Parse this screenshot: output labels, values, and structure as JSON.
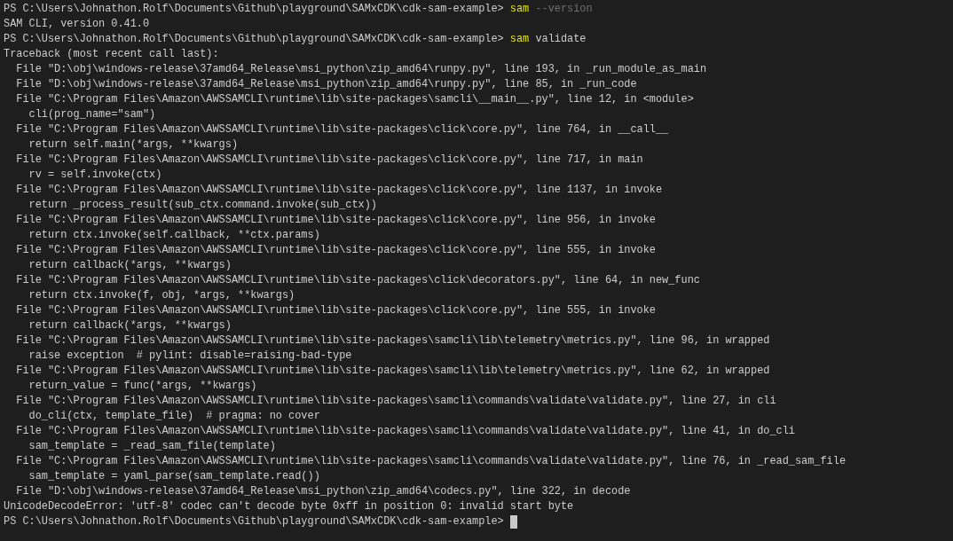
{
  "terminal": {
    "lines": [
      {
        "kind": "prompt",
        "prompt": "PS C:\\Users\\Johnathon.Rolf\\Documents\\Github\\playground\\SAMxCDK\\cdk-sam-example>",
        "tokens": [
          {
            "text": "sam",
            "kind": "command"
          },
          {
            "text": "--version",
            "kind": "parameter"
          }
        ],
        "cursor": false
      },
      {
        "kind": "output",
        "text": "SAM CLI, version 0.41.0"
      },
      {
        "kind": "prompt",
        "prompt": "PS C:\\Users\\Johnathon.Rolf\\Documents\\Github\\playground\\SAMxCDK\\cdk-sam-example>",
        "tokens": [
          {
            "text": "sam",
            "kind": "command"
          },
          {
            "text": "validate",
            "kind": "argument"
          }
        ],
        "cursor": false
      },
      {
        "kind": "output",
        "text": "Traceback (most recent call last):"
      },
      {
        "kind": "output",
        "text": "  File \"D:\\obj\\windows-release\\37amd64_Release\\msi_python\\zip_amd64\\runpy.py\", line 193, in _run_module_as_main"
      },
      {
        "kind": "output",
        "text": "  File \"D:\\obj\\windows-release\\37amd64_Release\\msi_python\\zip_amd64\\runpy.py\", line 85, in _run_code"
      },
      {
        "kind": "output",
        "text": "  File \"C:\\Program Files\\Amazon\\AWSSAMCLI\\runtime\\lib\\site-packages\\samcli\\__main__.py\", line 12, in <module>"
      },
      {
        "kind": "output",
        "text": "    cli(prog_name=\"sam\")"
      },
      {
        "kind": "output",
        "text": "  File \"C:\\Program Files\\Amazon\\AWSSAMCLI\\runtime\\lib\\site-packages\\click\\core.py\", line 764, in __call__"
      },
      {
        "kind": "output",
        "text": "    return self.main(*args, **kwargs)"
      },
      {
        "kind": "output",
        "text": "  File \"C:\\Program Files\\Amazon\\AWSSAMCLI\\runtime\\lib\\site-packages\\click\\core.py\", line 717, in main"
      },
      {
        "kind": "output",
        "text": "    rv = self.invoke(ctx)"
      },
      {
        "kind": "output",
        "text": "  File \"C:\\Program Files\\Amazon\\AWSSAMCLI\\runtime\\lib\\site-packages\\click\\core.py\", line 1137, in invoke"
      },
      {
        "kind": "output",
        "text": "    return _process_result(sub_ctx.command.invoke(sub_ctx))"
      },
      {
        "kind": "output",
        "text": "  File \"C:\\Program Files\\Amazon\\AWSSAMCLI\\runtime\\lib\\site-packages\\click\\core.py\", line 956, in invoke"
      },
      {
        "kind": "output",
        "text": "    return ctx.invoke(self.callback, **ctx.params)"
      },
      {
        "kind": "output",
        "text": "  File \"C:\\Program Files\\Amazon\\AWSSAMCLI\\runtime\\lib\\site-packages\\click\\core.py\", line 555, in invoke"
      },
      {
        "kind": "output",
        "text": "    return callback(*args, **kwargs)"
      },
      {
        "kind": "output",
        "text": "  File \"C:\\Program Files\\Amazon\\AWSSAMCLI\\runtime\\lib\\site-packages\\click\\decorators.py\", line 64, in new_func"
      },
      {
        "kind": "output",
        "text": "    return ctx.invoke(f, obj, *args, **kwargs)"
      },
      {
        "kind": "output",
        "text": "  File \"C:\\Program Files\\Amazon\\AWSSAMCLI\\runtime\\lib\\site-packages\\click\\core.py\", line 555, in invoke"
      },
      {
        "kind": "output",
        "text": "    return callback(*args, **kwargs)"
      },
      {
        "kind": "output",
        "text": "  File \"C:\\Program Files\\Amazon\\AWSSAMCLI\\runtime\\lib\\site-packages\\samcli\\lib\\telemetry\\metrics.py\", line 96, in wrapped"
      },
      {
        "kind": "output",
        "text": "    raise exception  # pylint: disable=raising-bad-type"
      },
      {
        "kind": "output",
        "text": "  File \"C:\\Program Files\\Amazon\\AWSSAMCLI\\runtime\\lib\\site-packages\\samcli\\lib\\telemetry\\metrics.py\", line 62, in wrapped"
      },
      {
        "kind": "output",
        "text": "    return_value = func(*args, **kwargs)"
      },
      {
        "kind": "output",
        "text": "  File \"C:\\Program Files\\Amazon\\AWSSAMCLI\\runtime\\lib\\site-packages\\samcli\\commands\\validate\\validate.py\", line 27, in cli"
      },
      {
        "kind": "output",
        "text": "    do_cli(ctx, template_file)  # pragma: no cover"
      },
      {
        "kind": "output",
        "text": "  File \"C:\\Program Files\\Amazon\\AWSSAMCLI\\runtime\\lib\\site-packages\\samcli\\commands\\validate\\validate.py\", line 41, in do_cli"
      },
      {
        "kind": "output",
        "text": "    sam_template = _read_sam_file(template)"
      },
      {
        "kind": "output",
        "text": "  File \"C:\\Program Files\\Amazon\\AWSSAMCLI\\runtime\\lib\\site-packages\\samcli\\commands\\validate\\validate.py\", line 76, in _read_sam_file"
      },
      {
        "kind": "output",
        "text": "    sam_template = yaml_parse(sam_template.read())"
      },
      {
        "kind": "output",
        "text": "  File \"D:\\obj\\windows-release\\37amd64_Release\\msi_python\\zip_amd64\\codecs.py\", line 322, in decode"
      },
      {
        "kind": "output",
        "text": "UnicodeDecodeError: 'utf-8' codec can't decode byte 0xff in position 0: invalid start byte"
      },
      {
        "kind": "prompt",
        "prompt": "PS C:\\Users\\Johnathon.Rolf\\Documents\\Github\\playground\\SAMxCDK\\cdk-sam-example>",
        "cursor": true
      }
    ]
  }
}
